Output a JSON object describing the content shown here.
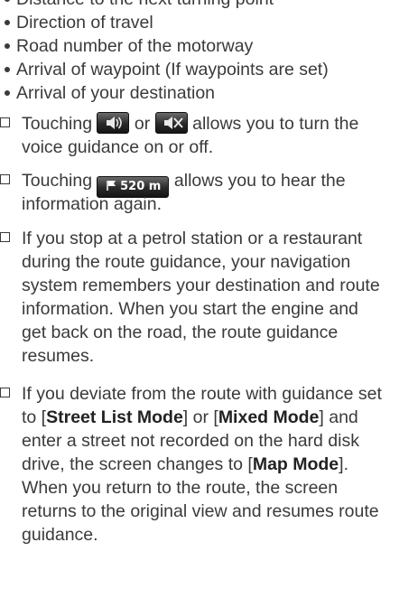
{
  "bullets": [
    "Distance to the next turning point",
    "Direction of travel",
    "Road number of the motorway",
    "Arrival of waypoint (If waypoints are set)",
    "Arrival of your destination"
  ],
  "notes": {
    "voice": {
      "line1_pre": "Touching",
      "or": "or",
      "line1_post": "allows you to turn the",
      "line2": "voice guidance on or off."
    },
    "repeat": {
      "line1_pre": "Touching",
      "button_label": "520 m",
      "line1_post": "allows you to hear the",
      "line2": "information again."
    },
    "petrol": {
      "lines": [
        "If you stop at a petrol station or a restaurant",
        "during the route guidance, your navigation",
        "system remembers your destination and route",
        "information. When you start the engine and",
        "get back on the road, the route guidance",
        "resumes."
      ]
    },
    "deviate": {
      "l1": "If you deviate from the route with guidance set",
      "l2_a": "to [",
      "l2_b": "Street List Mode",
      "l2_c": "] or [",
      "l2_d": "Mixed Mode",
      "l2_e": "] and",
      "l3": "enter a street not recorded on the hard disk",
      "l4_a": "drive, the screen changes to [",
      "l4_b": "Map Mode",
      "l4_c": "].",
      "l5": "When you return to the route, the screen",
      "l6": "returns to the original view and resumes route",
      "l7": "guidance."
    }
  },
  "icons": {
    "voice_on": "speaker-icon",
    "voice_off": "speaker-mute-icon",
    "distance": "flag-icon"
  }
}
